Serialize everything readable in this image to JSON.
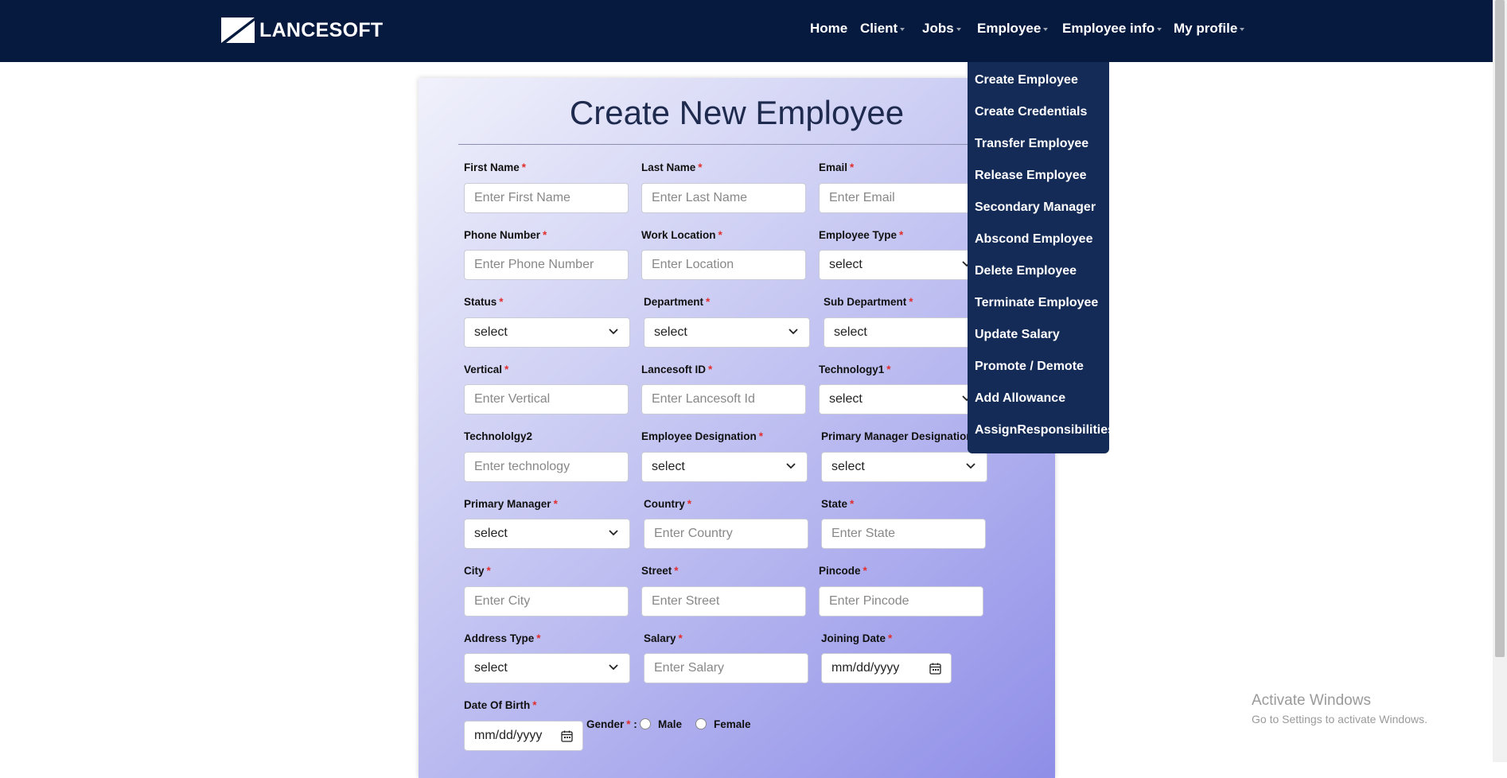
{
  "brand": {
    "name": "LANCESOFT",
    "nav_bg": "#061a40",
    "menu_bg": "#142b57"
  },
  "nav": {
    "items": [
      {
        "label": "Home",
        "has_caret": false
      },
      {
        "label": "Client",
        "has_caret": true
      },
      {
        "label": "Jobs",
        "has_caret": true
      },
      {
        "label": "Employee",
        "has_caret": true
      },
      {
        "label": "Employee info",
        "has_caret": true
      },
      {
        "label": "My profile",
        "has_caret": true
      }
    ]
  },
  "employee_menu": {
    "items": [
      "Create Employee",
      "Create Credentials",
      "Transfer Employee",
      "Release Employee",
      "Secondary Manager",
      "Abscond Employee",
      "Delete Employee",
      "Terminate Employee",
      "Update Salary",
      "Promote / Demote",
      "Add Allowance",
      "AssignResponsibilities"
    ]
  },
  "form": {
    "title": "Create New Employee",
    "required_mark": "*",
    "fields": {
      "first_name": {
        "label": "First Name",
        "placeholder": "Enter First Name"
      },
      "last_name": {
        "label": "Last Name",
        "placeholder": "Enter Last Name"
      },
      "email": {
        "label": "Email",
        "placeholder": "Enter Email"
      },
      "phone": {
        "label": "Phone Number",
        "placeholder": "Enter Phone Number"
      },
      "work_location": {
        "label": "Work Location",
        "placeholder": "Enter Location"
      },
      "employee_type": {
        "label": "Employee Type",
        "value": "select"
      },
      "status": {
        "label": "Status",
        "value": "select"
      },
      "department": {
        "label": "Department",
        "value": "select"
      },
      "sub_department": {
        "label": "Sub Department",
        "value": "select"
      },
      "vertical": {
        "label": "Vertical",
        "placeholder": "Enter Vertical"
      },
      "lancesoft_id": {
        "label": "Lancesoft ID",
        "placeholder": "Enter Lancesoft Id"
      },
      "technology1": {
        "label": "Technology1",
        "value": "select"
      },
      "technology2": {
        "label": "Technololgy2",
        "placeholder": "Enter technology"
      },
      "designation": {
        "label": "Employee Designation",
        "value": "select"
      },
      "primary_manager_designation": {
        "label": "Primary Manager Designation",
        "value": "select"
      },
      "primary_manager": {
        "label": "Primary Manager",
        "value": "select"
      },
      "country": {
        "label": "Country",
        "placeholder": "Enter Country"
      },
      "state": {
        "label": "State",
        "placeholder": "Enter State"
      },
      "city": {
        "label": "City",
        "placeholder": "Enter City"
      },
      "street": {
        "label": "Street",
        "placeholder": "Enter Street"
      },
      "pincode": {
        "label": "Pincode",
        "placeholder": "Enter Pincode"
      },
      "address_type": {
        "label": "Address Type",
        "value": "select"
      },
      "salary": {
        "label": "Salary",
        "placeholder": "Enter Salary"
      },
      "joining_date": {
        "label": "Joining Date",
        "value": "mm/dd/yyyy"
      },
      "dob": {
        "label": "Date Of Birth",
        "value": "mm/dd/yyyy"
      },
      "gender": {
        "label": "Gender",
        "separator": ":",
        "options": [
          "Male",
          "Female"
        ]
      }
    }
  },
  "watermark": {
    "title": "Activate Windows",
    "subtitle": "Go to Settings to activate Windows."
  }
}
